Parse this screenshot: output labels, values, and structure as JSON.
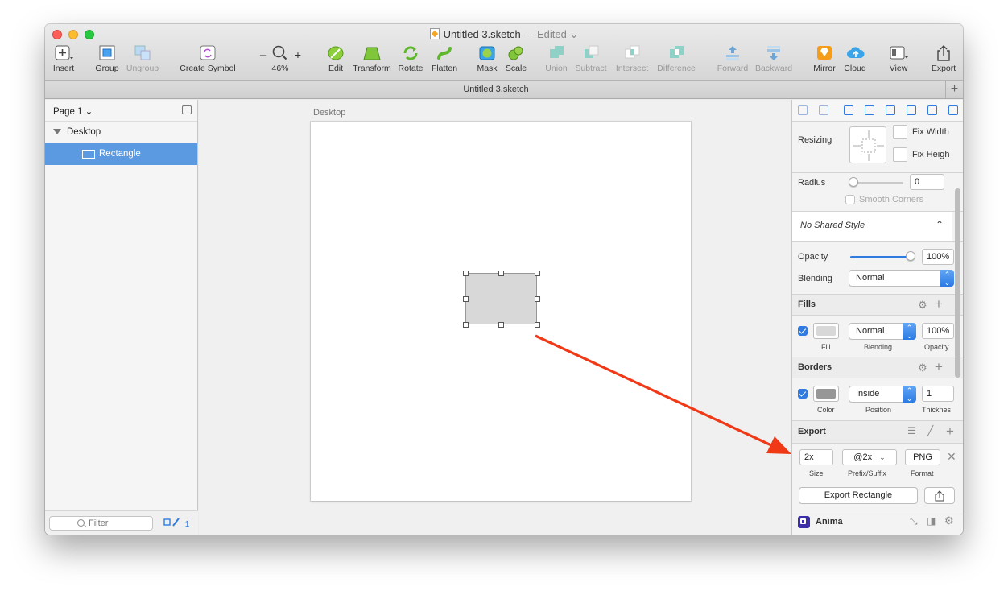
{
  "window": {
    "title": "Untitled 3.sketch",
    "title_status": "— Edited ⌄"
  },
  "toolbar": {
    "insert": "Insert",
    "group": "Group",
    "ungroup": "Ungroup",
    "create_symbol": "Create Symbol",
    "zoom_minus": "–",
    "zoom_plus": "+",
    "zoom_level": "46%",
    "edit": "Edit",
    "transform": "Transform",
    "rotate": "Rotate",
    "flatten": "Flatten",
    "mask": "Mask",
    "scale": "Scale",
    "union": "Union",
    "subtract": "Subtract",
    "intersect": "Intersect",
    "difference": "Difference",
    "forward": "Forward",
    "backward": "Backward",
    "mirror": "Mirror",
    "cloud": "Cloud",
    "view": "View",
    "export": "Export"
  },
  "tabbar": {
    "title": "Untitled 3.sketch",
    "add": "+"
  },
  "sidebar": {
    "page_selector": "Page 1 ⌄",
    "layers": [
      {
        "label": "Desktop",
        "type": "artboard"
      },
      {
        "label": "Rectangle",
        "type": "rectangle",
        "selected": true
      }
    ],
    "filter_placeholder": "Filter",
    "filter_count": "1"
  },
  "canvas": {
    "artboard_label": "Desktop"
  },
  "inspector": {
    "resizing_label": "Resizing",
    "fix_width": "Fix Width",
    "fix_height": "Fix Heigh",
    "radius_label": "Radius",
    "radius_value": "0",
    "smooth_corners": "Smooth Corners",
    "shared_style": "No Shared Style",
    "opacity_label": "Opacity",
    "opacity_value": "100%",
    "opacity_fraction": 1.0,
    "blending_label": "Blending",
    "blending_value": "Normal",
    "fills": {
      "title": "Fills",
      "blending": "Normal",
      "opacity": "100%",
      "fill_caption": "Fill",
      "blending_caption": "Blending",
      "opacity_caption": "Opacity",
      "color": "#d8d8d8"
    },
    "borders": {
      "title": "Borders",
      "position": "Inside",
      "thickness": "1",
      "color_caption": "Color",
      "position_caption": "Position",
      "thickness_caption": "Thicknes",
      "color": "#979797"
    },
    "export": {
      "title": "Export",
      "size": "2x",
      "suffix": "@2x",
      "format": "PNG",
      "size_caption": "Size",
      "suffix_caption": "Prefix/Suffix",
      "format_caption": "Format",
      "export_button": "Export Rectangle"
    },
    "plugin": {
      "name": "Anima"
    }
  },
  "colors": {
    "accent": "#2f7be0",
    "selection": "#5b9ae0",
    "annotation_arrow": "#f03a17"
  }
}
